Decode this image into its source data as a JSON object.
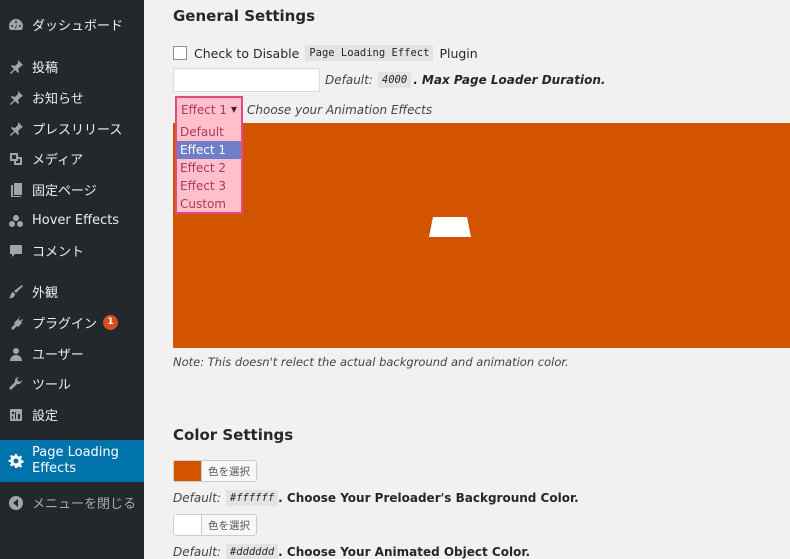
{
  "sidebar": {
    "items": [
      {
        "label": "ダッシュボード",
        "icon": "dashboard-icon"
      },
      {
        "label": "投稿",
        "icon": "pin-icon"
      },
      {
        "label": "お知らせ",
        "icon": "pin-icon"
      },
      {
        "label": "プレスリリース",
        "icon": "pin-icon"
      },
      {
        "label": "メディア",
        "icon": "media-icon"
      },
      {
        "label": "固定ページ",
        "icon": "page-icon"
      },
      {
        "label": "Hover Effects",
        "icon": "hover-effects-icon"
      },
      {
        "label": "コメント",
        "icon": "comment-icon"
      },
      {
        "label": "外観",
        "icon": "appearance-icon"
      },
      {
        "label": "プラグイン",
        "icon": "plugin-icon",
        "badge": "1"
      },
      {
        "label": "ユーザー",
        "icon": "user-icon"
      },
      {
        "label": "ツール",
        "icon": "tool-icon"
      },
      {
        "label": "設定",
        "icon": "settings-icon"
      },
      {
        "label": "Page Loading Effects",
        "icon": "gear-icon"
      },
      {
        "label": "メニューを閉じる",
        "icon": "collapse-icon"
      }
    ]
  },
  "general": {
    "title": "General Settings",
    "disable_label_pre": "Check to Disable",
    "disable_code": "Page Loading Effect",
    "disable_label_post": "Plugin",
    "duration_default_label": "Default:",
    "duration_default_value": "4000",
    "duration_desc": ". Max Page Loader Duration.",
    "animation_selected": "Effect 1",
    "animation_desc": "Choose your Animation Effects",
    "animation_options": [
      "Default",
      "Effect 1",
      "Effect 2",
      "Effect 3",
      "Custom"
    ],
    "preview_bg": "#d35400",
    "note": "Note: This doesn't relect the actual background and animation color."
  },
  "color": {
    "title": "Color Settings",
    "bg_swatch": "#d35400",
    "button_label": "色を選択",
    "bg_default_label": "Default:",
    "bg_default_value": "#ffffff",
    "bg_desc": ". Choose Your Preloader's Background Color.",
    "obj_swatch": "#ffffff",
    "obj_default_label": "Default:",
    "obj_default_value": "#dddddd",
    "obj_desc": ". Choose Your Animated Object Color."
  }
}
